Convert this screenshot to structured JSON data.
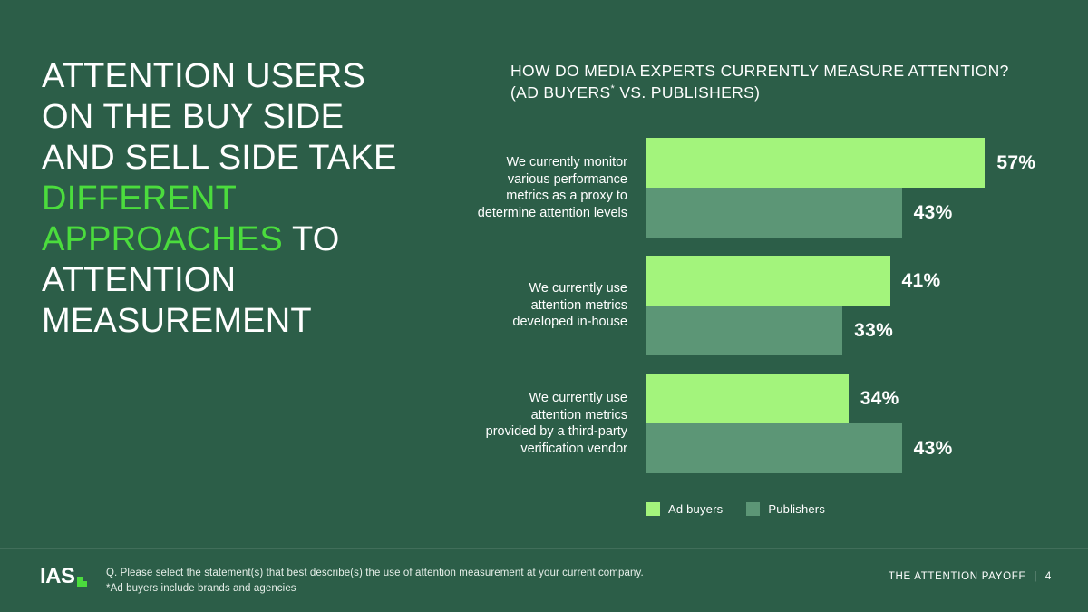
{
  "theme": {
    "background": "#2c5e48",
    "accent_green": "#4bdc3d",
    "bar_buyers": "#a3f47c",
    "bar_publishers": "#5c9676",
    "text": "#ffffff"
  },
  "headline": {
    "line1": "ATTENTION USERS",
    "line2": "ON THE BUY SIDE",
    "line3": "AND SELL SIDE TAKE",
    "accent1": "DIFFERENT",
    "accent2": "APPROACHES",
    "line4_tail": " TO",
    "line5": "ATTENTION",
    "line6": "MEASUREMENT"
  },
  "chart_title": {
    "line1": "HOW DO MEDIA EXPERTS CURRENTLY MEASURE ATTENTION?",
    "line2_pre": "(AD BUYERS",
    "line2_sup": "*",
    "line2_post": " VS. PUBLISHERS)"
  },
  "chart_data": {
    "type": "bar",
    "orientation": "horizontal",
    "title": "HOW DO MEDIA EXPERTS CURRENTLY MEASURE ATTENTION? (AD BUYERS* VS. PUBLISHERS)",
    "xlabel": "",
    "ylabel": "",
    "xlim": [
      0,
      60
    ],
    "grid": false,
    "legend_position": "bottom-left",
    "categories": [
      "We currently monitor various performance metrics as a proxy to determine attention levels",
      "We currently use attention metrics developed in-house",
      "We currently use attention metrics provided by a third-party verification vendor"
    ],
    "category_lines": [
      [
        "We currently monitor",
        "various performance",
        "metrics as a proxy to",
        "determine attention levels"
      ],
      [
        "We currently use",
        "attention metrics",
        "developed in-house"
      ],
      [
        "We currently use",
        "attention metrics",
        "provided by a third-party",
        "verification vendor"
      ]
    ],
    "series": [
      {
        "name": "Ad buyers",
        "color": "#a3f47c",
        "values": [
          57,
          41,
          34
        ],
        "labels": [
          "57%",
          "41%",
          "34%"
        ]
      },
      {
        "name": "Publishers",
        "color": "#5c9676",
        "values": [
          43,
          33,
          43
        ],
        "labels": [
          "43%",
          "33%",
          "43%"
        ]
      }
    ]
  },
  "legend": [
    {
      "label": "Ad buyers",
      "color": "#a3f47c"
    },
    {
      "label": "Publishers",
      "color": "#5c9676"
    }
  ],
  "footer": {
    "logo_text": "IAS",
    "note_line1": "Q. Please select the statement(s) that best describe(s) the use of attention measurement at your current company.",
    "note_line2": "*Ad buyers include brands and agencies",
    "deck_title": "THE ATTENTION PAYOFF",
    "separator": "|",
    "page_number": "4"
  }
}
